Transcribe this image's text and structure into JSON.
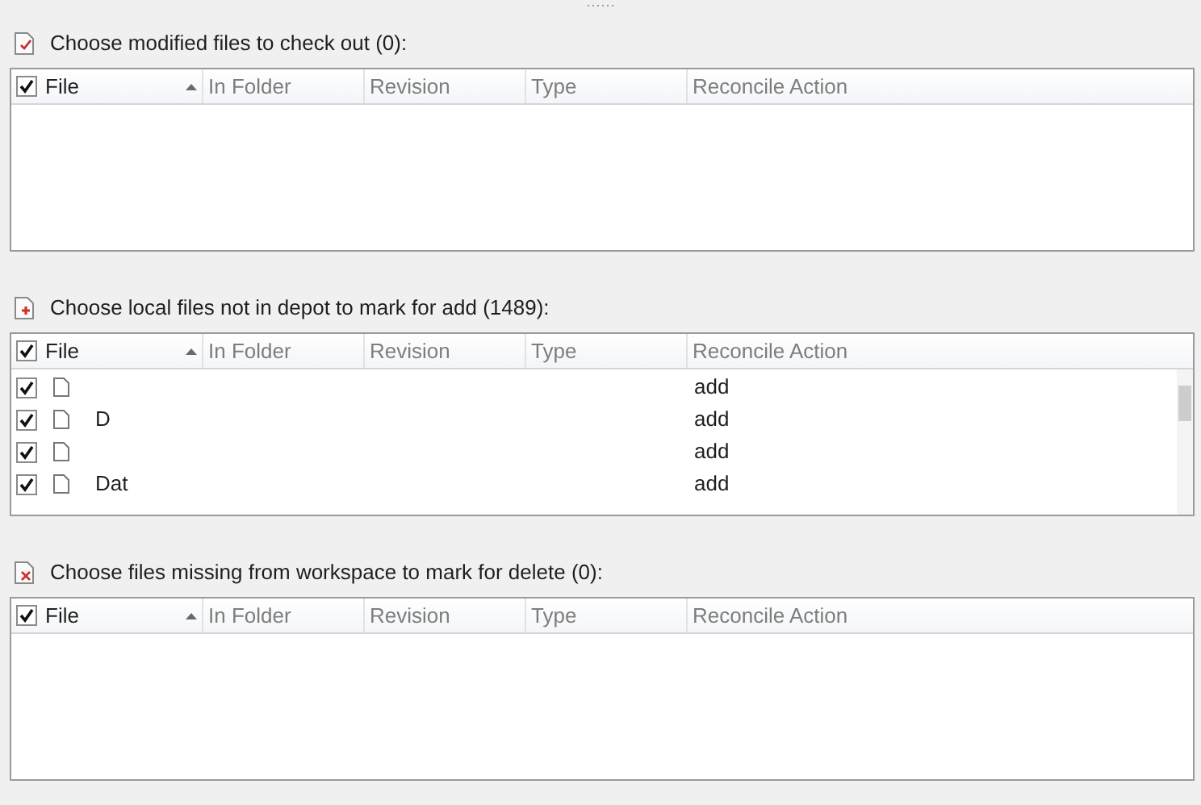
{
  "sections": [
    {
      "kind": "edit",
      "title": "Choose modified files to check out (0):",
      "columns": [
        {
          "label": "File",
          "checked": true,
          "sorted": true
        },
        {
          "label": "In Folder"
        },
        {
          "label": "Revision"
        },
        {
          "label": "Type"
        },
        {
          "label": "Reconcile Action"
        }
      ]
    },
    {
      "kind": "add",
      "title": "Choose local files not in depot to mark for add (1489):",
      "columns": [
        {
          "label": "File",
          "checked": true,
          "sorted": true
        },
        {
          "label": "In Folder"
        },
        {
          "label": "Revision"
        },
        {
          "label": "Type"
        },
        {
          "label": "Reconcile Action"
        }
      ],
      "rows": [
        {
          "checked": true,
          "action": "add"
        },
        {
          "checked": true,
          "file": "D",
          "action": "add"
        },
        {
          "checked": true,
          "action": "add"
        },
        {
          "checked": true,
          "file": "Dat",
          "action": "add"
        }
      ]
    },
    {
      "kind": "delete",
      "title": "Choose files missing from workspace to mark for delete (0):",
      "columns": [
        {
          "label": "File",
          "checked": true,
          "sorted": true
        },
        {
          "label": "In Folder"
        },
        {
          "label": "Revision"
        },
        {
          "label": "Type"
        },
        {
          "label": "Reconcile Action"
        }
      ]
    }
  ]
}
